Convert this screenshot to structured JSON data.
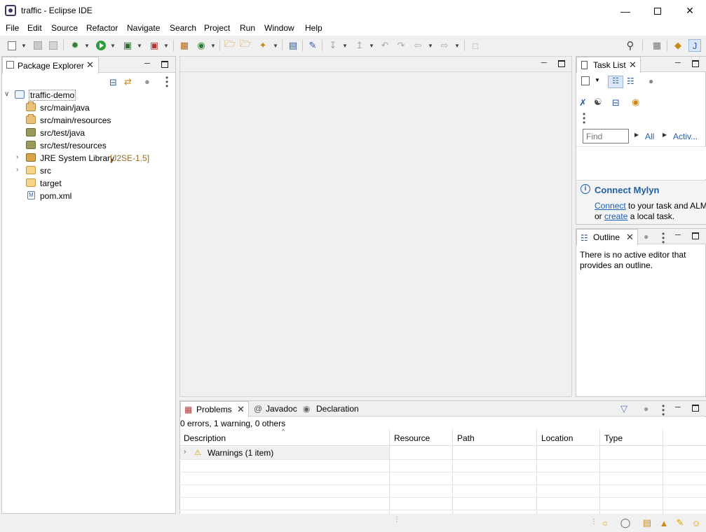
{
  "window": {
    "title": "traffic - Eclipse IDE",
    "minimize_icon": "minimize-icon",
    "maximize_icon": "maximize-icon",
    "close_icon": "close-icon"
  },
  "menu": [
    "File",
    "Edit",
    "Source",
    "Refactor",
    "Navigate",
    "Search",
    "Project",
    "Run",
    "Window",
    "Help"
  ],
  "package_explorer": {
    "tab_label": "Package Explorer",
    "tree": [
      {
        "label": "traffic-demo",
        "suffix": "",
        "icon": "project-icon",
        "expanded": true
      },
      {
        "label": "src/main/java",
        "suffix": "",
        "icon": "source-folder-icon"
      },
      {
        "label": "src/main/resources",
        "suffix": "",
        "icon": "source-folder-icon"
      },
      {
        "label": "src/test/java",
        "suffix": "",
        "icon": "test-source-folder-icon"
      },
      {
        "label": "src/test/resources",
        "suffix": "",
        "icon": "test-source-folder-icon"
      },
      {
        "label": "JRE System Library",
        "suffix": "[J2SE-1.5]",
        "icon": "library-icon",
        "expandable": true
      },
      {
        "label": "src",
        "suffix": "",
        "icon": "folder-icon",
        "expandable": true
      },
      {
        "label": "target",
        "suffix": "",
        "icon": "folder-icon"
      },
      {
        "label": "pom.xml",
        "suffix": "",
        "icon": "maven-file-icon"
      }
    ]
  },
  "task_list": {
    "tab_label": "Task List",
    "find_placeholder": "Find",
    "filter_all": "All",
    "filter_active": "Activ...",
    "connect_title": "Connect Mylyn",
    "connect_link": "Connect",
    "connect_text1": " to your task and ALM",
    "connect_or": "or ",
    "create_link": "create",
    "connect_text2": " a local task."
  },
  "outline": {
    "tab_label": "Outline",
    "message_line1": "There is no active editor that",
    "message_line2": "provides an outline."
  },
  "bottom_tabs": {
    "problems": "Problems",
    "javadoc": "Javadoc",
    "declaration": "Declaration"
  },
  "problems": {
    "summary": "0 errors, 1 warning, 0 others",
    "columns": [
      "Description",
      "Resource",
      "Path",
      "Location",
      "Type"
    ],
    "rows": [
      {
        "description": "Warnings (1 item)",
        "icon": "warning-icon"
      }
    ]
  },
  "colors": {
    "link": "#1a5fb4",
    "mylyn_title": "#1f5fa8",
    "library_suffix": "#9a6a2a"
  }
}
